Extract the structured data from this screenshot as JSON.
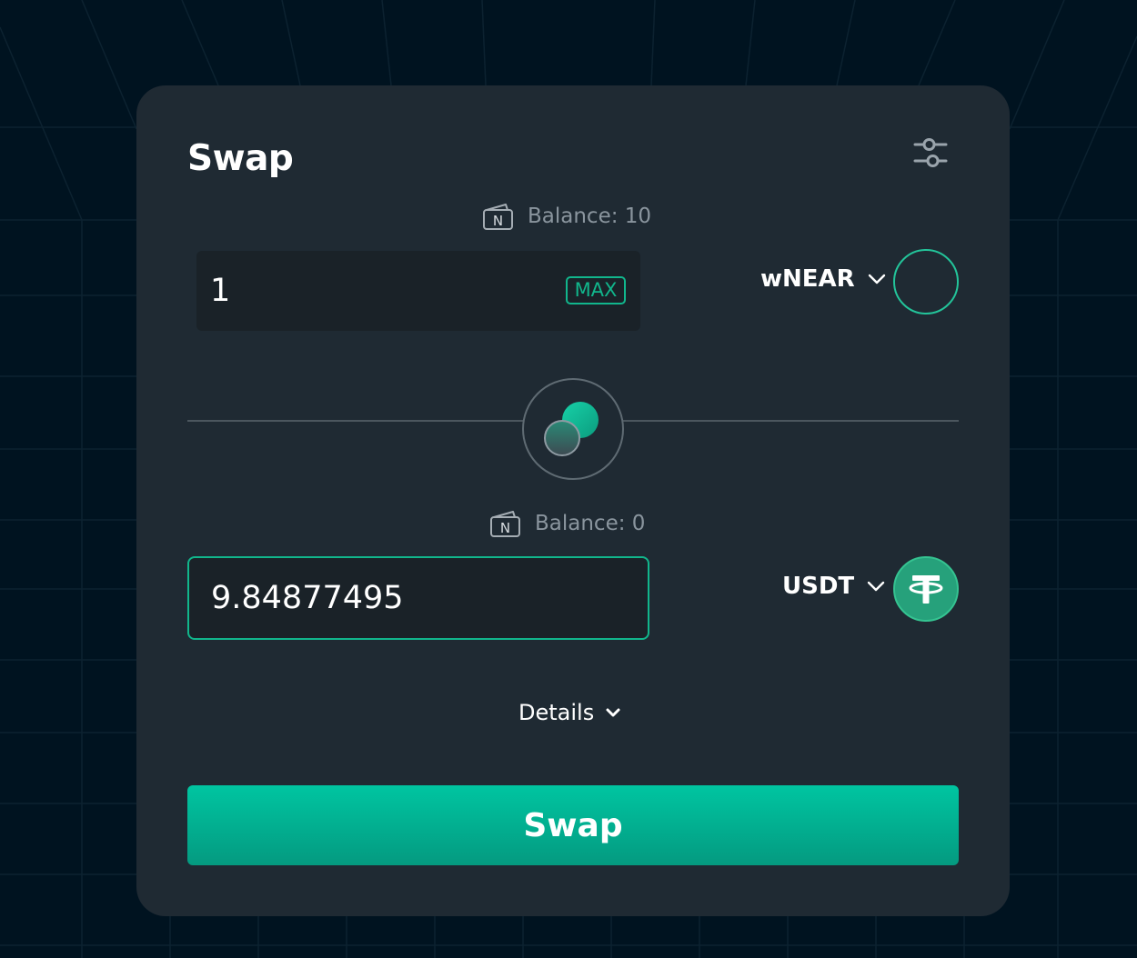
{
  "swap": {
    "title": "Swap",
    "from": {
      "balance_text": "Balance: 10",
      "amount": "1",
      "max_label": "MAX",
      "token": "wNEAR"
    },
    "to": {
      "balance_text": "Balance: 0",
      "amount": "9.84877495",
      "token": "USDT"
    },
    "details_label": "Details",
    "submit_label": "Swap",
    "wallet_icon_letter": "N"
  },
  "theme": {
    "background": "#001320",
    "card": "#1f2a33",
    "accent": "#11b68c",
    "input_bg": "#1a2228",
    "muted_text": "#8a959e"
  },
  "icons": {
    "settings": "sliders-icon",
    "wallet": "wallet-icon",
    "chevron": "chevron-down-icon",
    "switch": "switch-tokens-icon",
    "usdt": "tether-logo-icon"
  }
}
